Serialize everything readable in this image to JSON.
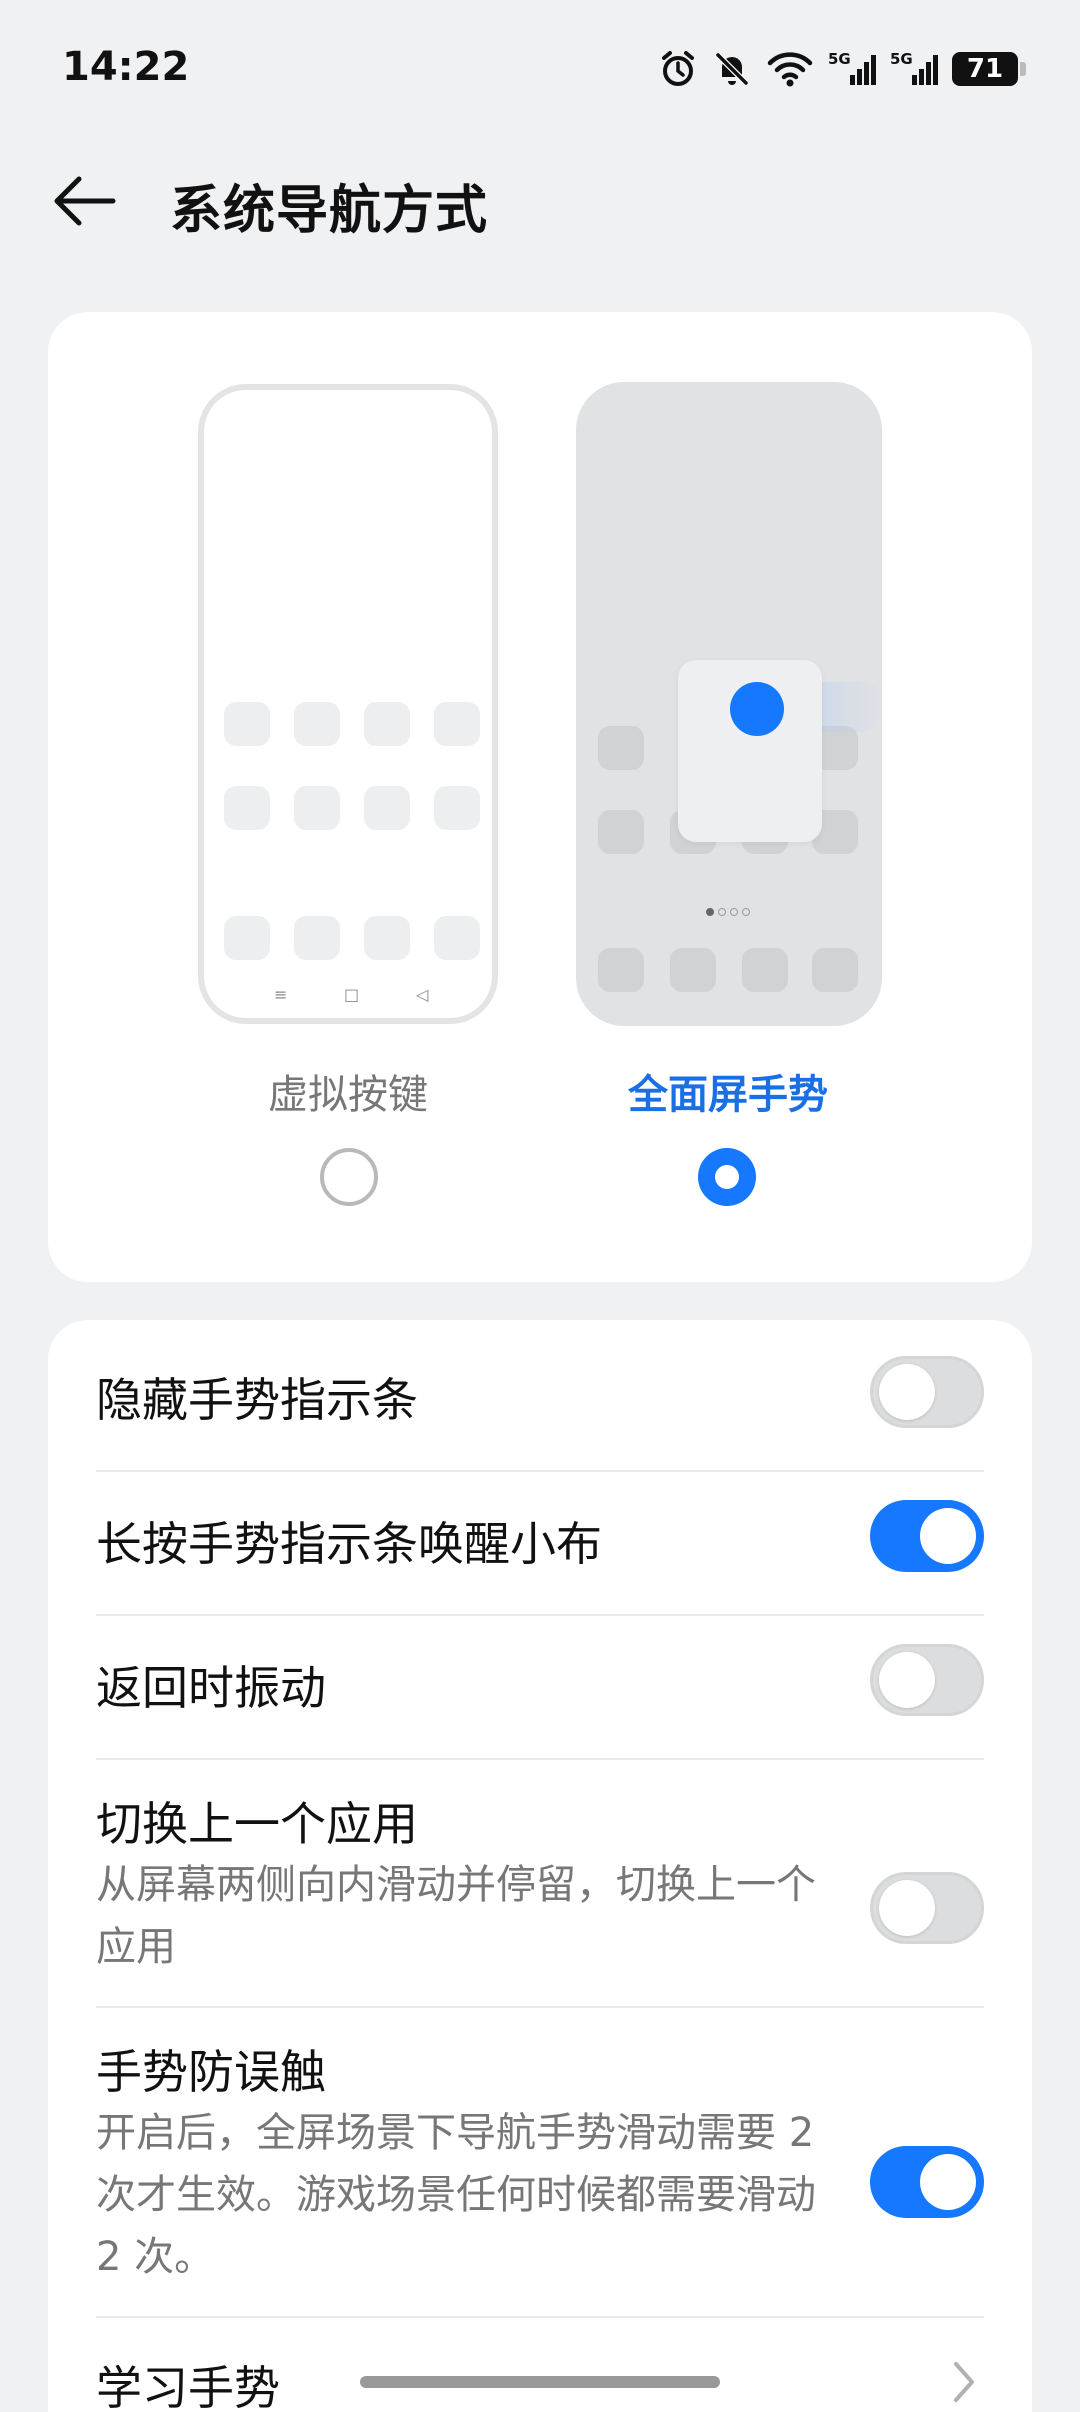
{
  "status_bar": {
    "time": "14:22",
    "icons": [
      "alarm-icon",
      "bell-muted-icon",
      "wifi-icon",
      "signal-5g-icon",
      "signal-5g-icon"
    ],
    "signal_label_1": "5G",
    "signal_label_2": "5G",
    "battery": "71"
  },
  "header": {
    "title": "系统导航方式",
    "back_icon": "arrow-left-icon"
  },
  "navigation_mode": {
    "options": [
      {
        "label": "虚拟按键",
        "selected": false
      },
      {
        "label": "全面屏手势",
        "selected": true
      }
    ],
    "nav_keys": [
      "≡",
      "□",
      "◁"
    ],
    "accent_color": "#1677ff"
  },
  "settings": {
    "items": [
      {
        "title": "隐藏手势指示条",
        "toggle": false
      },
      {
        "title": "长按手势指示条唤醒小布",
        "toggle": true
      },
      {
        "title": "返回时振动",
        "toggle": false
      },
      {
        "title": "切换上一个应用",
        "description": "从屏幕两侧向内滑动并停留，切换上一个应用",
        "toggle": false
      },
      {
        "title": "手势防误触",
        "description": "开启后，全屏场景下导航手势滑动需要 2 次才生效。游戏场景任何时候都需要滑动 2 次。",
        "toggle": true
      },
      {
        "title": "学习手势",
        "chevron": true
      }
    ]
  }
}
